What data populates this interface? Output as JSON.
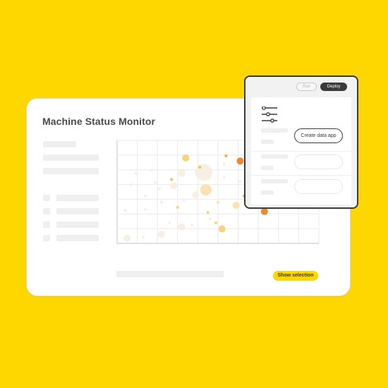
{
  "main": {
    "title": "Machine Status Monitor",
    "show_selection_label": "Show selection"
  },
  "panel": {
    "run_label": "Run",
    "deploy_label": "Deploy",
    "create_label": "Create data app"
  },
  "colors": {
    "background": "#FFD700",
    "accent": "#FFD700",
    "dark": "#3A3A3A",
    "placeholder": "#EFEFEF",
    "bubble_palette": [
      "#F6EFE2",
      "#FBE2B0",
      "#F9D27E",
      "#F7BE5A",
      "#F5A24A",
      "#F08830"
    ]
  },
  "icons": {
    "config": "sliders-icon"
  },
  "chart_data": {
    "type": "scatter",
    "title": "",
    "xlabel": "",
    "ylabel": "",
    "grid": true,
    "xlim": [
      0,
      10
    ],
    "ylim": [
      0,
      10
    ],
    "points": [
      {
        "x": 0.5,
        "y": 0.5,
        "size": 2,
        "level": 0
      },
      {
        "x": 1.3,
        "y": 0.6,
        "size": 1,
        "level": 0
      },
      {
        "x": 2.2,
        "y": 0.9,
        "size": 2,
        "level": 0
      },
      {
        "x": 0.4,
        "y": 3.2,
        "size": 1,
        "level": 0
      },
      {
        "x": 1.4,
        "y": 3.3,
        "size": 1,
        "level": 0
      },
      {
        "x": 1.4,
        "y": 4.6,
        "size": 1,
        "level": 0
      },
      {
        "x": 0.7,
        "y": 5.7,
        "size": 1,
        "level": 0
      },
      {
        "x": 1.9,
        "y": 5.9,
        "size": 1,
        "level": 0
      },
      {
        "x": 0.9,
        "y": 6.8,
        "size": 1,
        "level": 0
      },
      {
        "x": 1.7,
        "y": 7.1,
        "size": 1,
        "level": 0
      },
      {
        "x": 2.1,
        "y": 5.3,
        "size": 1,
        "level": 0
      },
      {
        "x": 2.2,
        "y": 4.0,
        "size": 1,
        "level": 0
      },
      {
        "x": 2.6,
        "y": 2.0,
        "size": 1,
        "level": 0
      },
      {
        "x": 3.2,
        "y": 1.6,
        "size": 2,
        "level": 0
      },
      {
        "x": 3.3,
        "y": 4.2,
        "size": 1,
        "level": 0
      },
      {
        "x": 3.4,
        "y": 8.3,
        "size": 2,
        "level": 2
      },
      {
        "x": 2.8,
        "y": 5.6,
        "size": 2,
        "level": 0
      },
      {
        "x": 2.7,
        "y": 6.2,
        "size": 1,
        "level": 3
      },
      {
        "x": 3.0,
        "y": 3.5,
        "size": 1,
        "level": 2
      },
      {
        "x": 3.7,
        "y": 1.8,
        "size": 1,
        "level": 0
      },
      {
        "x": 3.2,
        "y": 6.8,
        "size": 2,
        "level": 0
      },
      {
        "x": 3.9,
        "y": 4.7,
        "size": 2,
        "level": 0
      },
      {
        "x": 4.3,
        "y": 6.9,
        "size": 4,
        "level": 0
      },
      {
        "x": 4.4,
        "y": 5.2,
        "size": 3,
        "level": 1
      },
      {
        "x": 4.1,
        "y": 7.4,
        "size": 1,
        "level": 3
      },
      {
        "x": 4.6,
        "y": 2.4,
        "size": 1,
        "level": 0
      },
      {
        "x": 4.9,
        "y": 2.0,
        "size": 1,
        "level": 2
      },
      {
        "x": 4.5,
        "y": 3.0,
        "size": 1,
        "level": 2
      },
      {
        "x": 5.0,
        "y": 4.0,
        "size": 1,
        "level": 1
      },
      {
        "x": 5.2,
        "y": 1.4,
        "size": 2,
        "level": 2
      },
      {
        "x": 5.3,
        "y": 6.4,
        "size": 1,
        "level": 0
      },
      {
        "x": 5.3,
        "y": 7.7,
        "size": 1,
        "level": 0
      },
      {
        "x": 5.4,
        "y": 8.5,
        "size": 1,
        "level": 4
      },
      {
        "x": 5.9,
        "y": 3.7,
        "size": 2,
        "level": 1
      },
      {
        "x": 6.1,
        "y": 6.0,
        "size": 1,
        "level": 0
      },
      {
        "x": 6.1,
        "y": 8.0,
        "size": 2,
        "level": 5
      },
      {
        "x": 6.3,
        "y": 4.6,
        "size": 1,
        "level": 4
      },
      {
        "x": 7.3,
        "y": 3.1,
        "size": 2,
        "level": 5
      }
    ]
  }
}
